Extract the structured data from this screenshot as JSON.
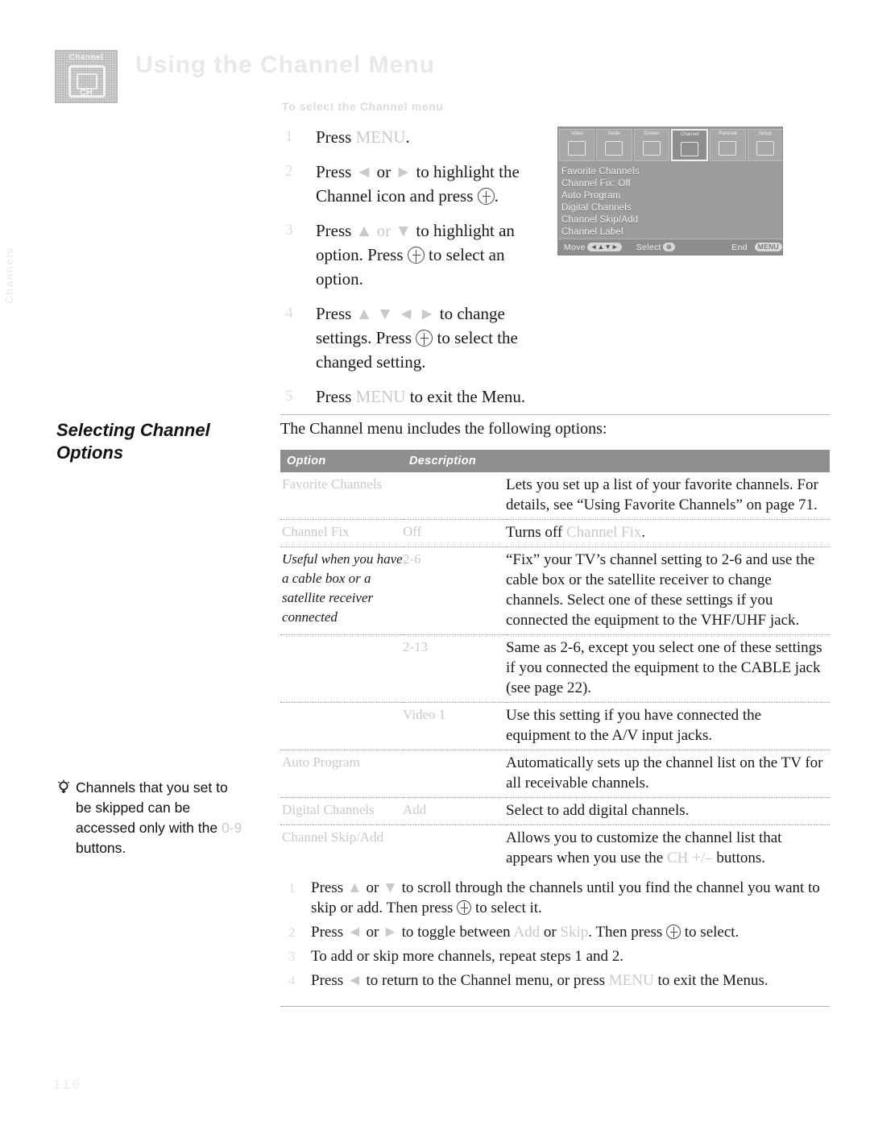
{
  "page": {
    "side_tab": "Channels",
    "footer_page": "116"
  },
  "header": {
    "badge_label": "Channel",
    "badge_sub": "CH",
    "title": "Using the Channel Menu"
  },
  "intro": {
    "steps_heading": "To select the Channel menu",
    "steps": [
      {
        "num": "1",
        "parts": [
          {
            "t": "text",
            "v": "Press "
          },
          {
            "t": "faded",
            "v": "MENU"
          },
          {
            "t": "text",
            "v": "."
          }
        ]
      },
      {
        "num": "2",
        "parts": [
          {
            "t": "text",
            "v": "Press "
          },
          {
            "t": "faded",
            "v": "◄"
          },
          {
            "t": "text",
            "v": " or "
          },
          {
            "t": "faded",
            "v": "►"
          },
          {
            "t": "text",
            "v": " to highlight the Channel icon and press "
          },
          {
            "t": "key",
            "v": ""
          },
          {
            "t": "text",
            "v": "."
          }
        ]
      },
      {
        "num": "3",
        "parts": [
          {
            "t": "text",
            "v": "Press "
          },
          {
            "t": "faded",
            "v": "▲ or ▼"
          },
          {
            "t": "text",
            "v": " to highlight an option. Press "
          },
          {
            "t": "key",
            "v": ""
          },
          {
            "t": "text",
            "v": " to select an option."
          }
        ]
      },
      {
        "num": "4",
        "parts": [
          {
            "t": "text",
            "v": "Press "
          },
          {
            "t": "faded",
            "v": "▲ ▼ ◄ ►"
          },
          {
            "t": "text",
            "v": " to change settings. Press "
          },
          {
            "t": "key",
            "v": ""
          },
          {
            "t": "text",
            "v": " to select the changed setting."
          }
        ]
      },
      {
        "num": "5",
        "parts": [
          {
            "t": "text",
            "v": "Press "
          },
          {
            "t": "faded",
            "v": "MENU"
          },
          {
            "t": "text",
            "v": " to exit the Menu."
          }
        ]
      }
    ]
  },
  "tv_screenshot": {
    "icons": [
      {
        "label": "Video",
        "selected": false
      },
      {
        "label": "Audio",
        "selected": false
      },
      {
        "label": "Screen",
        "selected": false
      },
      {
        "label": "Channel",
        "selected": true
      },
      {
        "label": "Parental",
        "selected": false
      },
      {
        "label": "Setup",
        "selected": false
      }
    ],
    "menu_items": [
      "Favorite Channels",
      "Channel Fix: Off",
      "Auto Program",
      "Digital Channels",
      "Channel Skip/Add",
      "Channel Label"
    ],
    "bottom_bar": {
      "move_label": "Move",
      "move_keys": "◄▲▼►",
      "select_label": "Select",
      "select_key": "⊕",
      "end_label": "End",
      "end_key": "MENU"
    }
  },
  "section": {
    "heading_line1": "Selecting Channel",
    "heading_line2": "Options",
    "intro": "The Channel menu includes the following options:"
  },
  "table": {
    "headers": {
      "option": "Option",
      "description": "Description"
    },
    "rows": [
      {
        "option": "Favorite Channels",
        "option_faded": true,
        "value": "",
        "desc": "Lets you set up a list of your favorite channels. For details, see “Using Favorite Channels” on page 71."
      },
      {
        "option": "Channel Fix",
        "option_faded": true,
        "value": "Off",
        "value_faded": true,
        "desc_pre": "Turns off ",
        "desc_faded": "Channel Fix",
        "desc_post": "."
      },
      {
        "option_note": "Useful when you have a cable box or a satellite receiver connected",
        "value": "2-6",
        "value_faded": true,
        "desc": "“Fix” your TV’s channel setting to 2-6 and use the cable box or the satellite receiver to change channels. Select one of these settings if you connected the equipment to the VHF/UHF jack."
      },
      {
        "option": "",
        "value": "2-13",
        "value_faded": true,
        "desc": "Same as 2-6, except you select one of these settings if you connected the equipment to the CABLE jack (see page 22)."
      },
      {
        "option": "",
        "value": "Video 1",
        "value_faded": true,
        "desc": "Use this setting if you have connected the equipment to the A/V input jacks."
      },
      {
        "option": "Auto Program",
        "option_faded": true,
        "value": "",
        "desc": "Automatically sets up the channel list on the TV for all receivable channels."
      },
      {
        "option": "Digital Channels",
        "option_faded": true,
        "value": "Add",
        "value_faded": true,
        "desc": "Select to add digital channels."
      },
      {
        "option": "Channel Skip/Add",
        "option_faded": true,
        "value": "",
        "desc_pre": "Allows you to customize the channel list that appears when you use the ",
        "desc_faded": "CH +/–",
        "desc_post": " buttons."
      }
    ],
    "substeps": [
      {
        "num": "1",
        "parts": [
          {
            "t": "text",
            "v": "Press "
          },
          {
            "t": "faded",
            "v": "▲"
          },
          {
            "t": "text",
            "v": " or "
          },
          {
            "t": "faded",
            "v": "▼"
          },
          {
            "t": "text",
            "v": " to scroll through the channels until you find the channel you want to skip or add. Then press "
          },
          {
            "t": "key",
            "v": ""
          },
          {
            "t": "text",
            "v": " to select it."
          }
        ]
      },
      {
        "num": "2",
        "parts": [
          {
            "t": "text",
            "v": "Press "
          },
          {
            "t": "faded",
            "v": "◄"
          },
          {
            "t": "text",
            "v": " or "
          },
          {
            "t": "faded",
            "v": "►"
          },
          {
            "t": "text",
            "v": " to toggle between "
          },
          {
            "t": "faded",
            "v": "Add"
          },
          {
            "t": "text",
            "v": " or "
          },
          {
            "t": "faded",
            "v": "Skip"
          },
          {
            "t": "text",
            "v": ". Then press "
          },
          {
            "t": "key",
            "v": ""
          },
          {
            "t": "text",
            "v": " to select."
          }
        ]
      },
      {
        "num": "3",
        "parts": [
          {
            "t": "text",
            "v": "To add or skip more channels, repeat steps 1 and 2."
          }
        ]
      },
      {
        "num": "4",
        "parts": [
          {
            "t": "text",
            "v": "Press "
          },
          {
            "t": "faded",
            "v": "◄"
          },
          {
            "t": "text",
            "v": " to return to the Channel menu, or press "
          },
          {
            "t": "faded",
            "v": "MENU"
          },
          {
            "t": "text",
            "v": " to exit the Menus."
          }
        ]
      }
    ]
  },
  "tip": {
    "icon": "lightbulb-icon",
    "parts": [
      {
        "t": "text",
        "v": "Channels that you set to be skipped can be accessed only with the "
      },
      {
        "t": "faded",
        "v": "0-9"
      },
      {
        "t": "text",
        "v": " buttons."
      }
    ]
  }
}
